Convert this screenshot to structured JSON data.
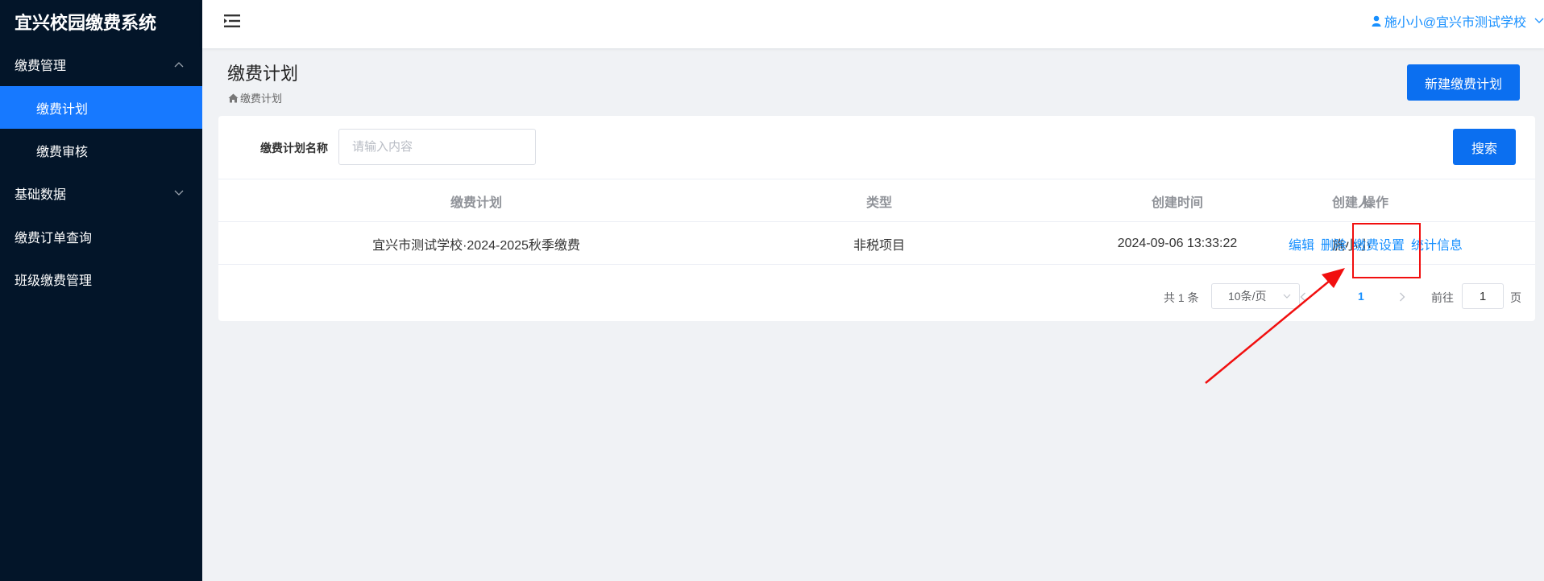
{
  "app": {
    "title": "宜兴校园缴费系统"
  },
  "sidebar": {
    "group_fee": {
      "label": "缴费管理"
    },
    "sub_items": [
      {
        "label": "缴费计划",
        "active": true
      },
      {
        "label": "缴费审核",
        "active": false
      }
    ],
    "group_basic": {
      "label": "基础数据"
    },
    "items": [
      {
        "label": "缴费订单查询"
      },
      {
        "label": "班级缴费管理"
      }
    ]
  },
  "header": {
    "user": "施小小@宜兴市测试学校"
  },
  "page": {
    "title": "缴费计划",
    "breadcrumb": "缴费计划",
    "new_button": "新建缴费计划"
  },
  "search": {
    "label": "缴费计划名称",
    "placeholder": "请输入内容",
    "value": "",
    "button": "搜索"
  },
  "table": {
    "headers": [
      "缴费计划",
      "类型",
      "创建时间",
      "创建人",
      "操作"
    ],
    "rows": [
      {
        "plan": "宜兴市测试学校·2024-2025秋季缴费",
        "type": "非税项目",
        "created": "2024-09-06 13:33:22",
        "creator": "施小小",
        "actions": [
          "编辑",
          "删除",
          "缴费设置",
          "统计信息"
        ]
      }
    ]
  },
  "pagination": {
    "total": "共 1 条",
    "page_size": "10条/页",
    "current": "1",
    "goto_label": "前往",
    "goto_value": "1",
    "page_suffix": "页"
  },
  "colors": {
    "sidebar_bg": "#031529",
    "active": "#1779ff",
    "primary": "#0b6ff0",
    "link": "#1890ff",
    "annotation": "#f10f0f"
  }
}
